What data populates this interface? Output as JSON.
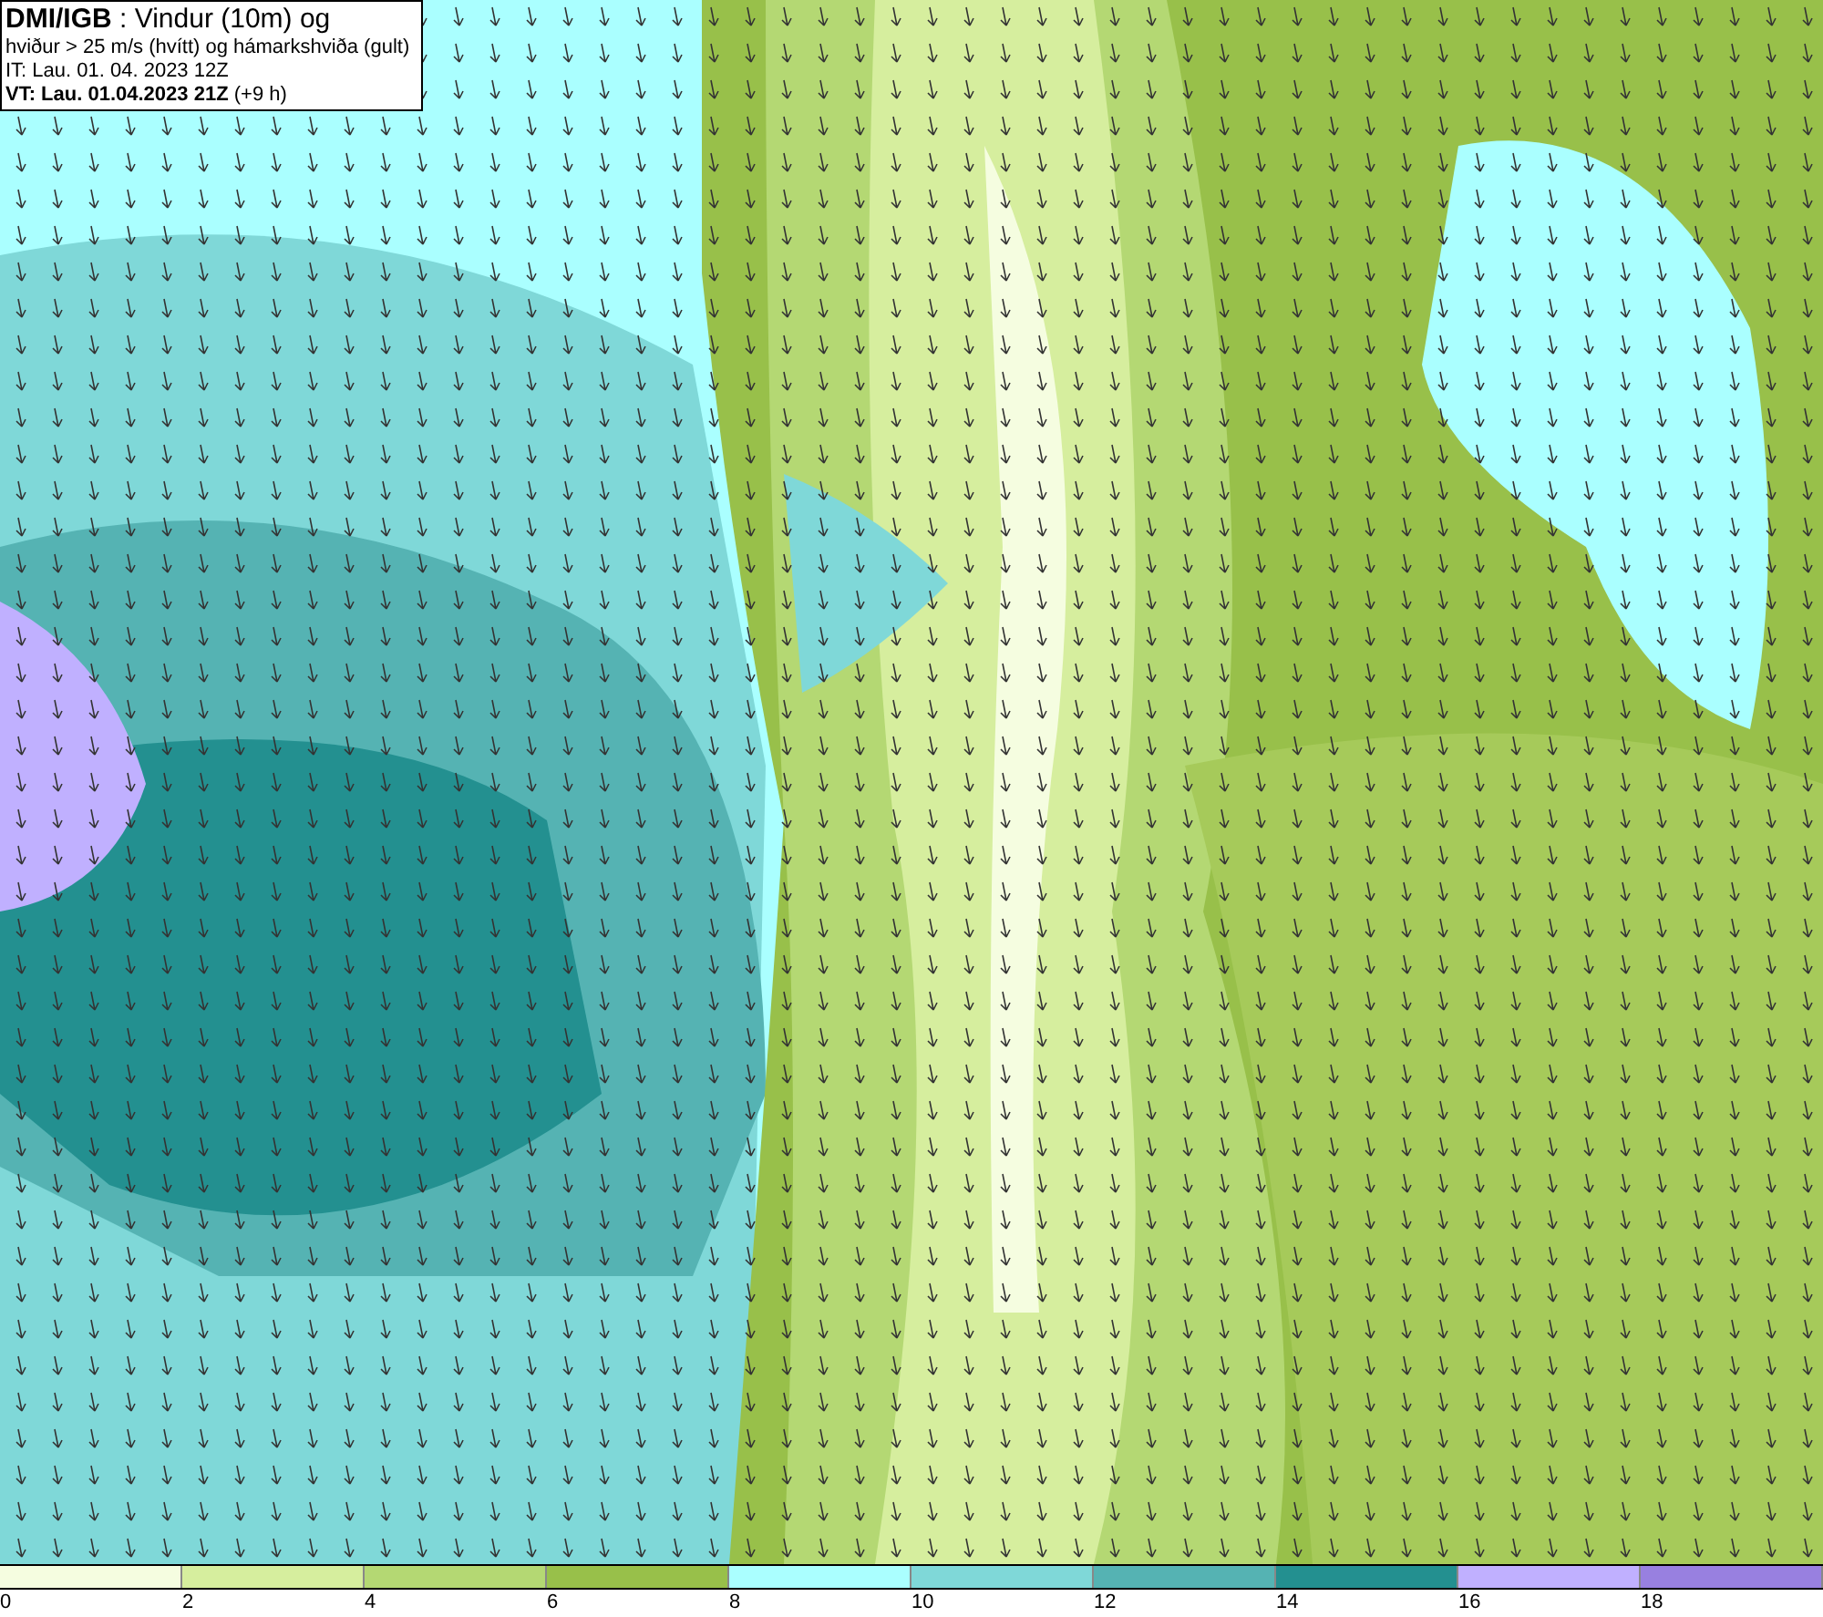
{
  "title_box": {
    "lines": [
      "**DMI/IGB** : Vindur (10m) og",
      "hviður > 25 m/s (hvítt) og hámarkshviða (gult)",
      "IT: Lau. 01. 04. 2023 12Z",
      "**VT: Lau. 01.04.2023 21Z** (+9 h)"
    ]
  },
  "legend": [
    {
      "label": "0",
      "color": "#f5fde0"
    },
    {
      "label": "2",
      "color": "#d6ee9e"
    },
    {
      "label": "4",
      "color": "#b4d873"
    },
    {
      "label": "6",
      "color": "#98c04a"
    },
    {
      "label": "8",
      "color": "#aaffff"
    },
    {
      "label": "10",
      "color": "#7fd8d8"
    },
    {
      "label": "12",
      "color": "#55b3b3"
    },
    {
      "label": "14",
      "color": "#239090"
    },
    {
      "label": "16",
      "color": "#c0b0ff"
    },
    {
      "label": "18",
      "color": "#9880e0"
    }
  ]
}
